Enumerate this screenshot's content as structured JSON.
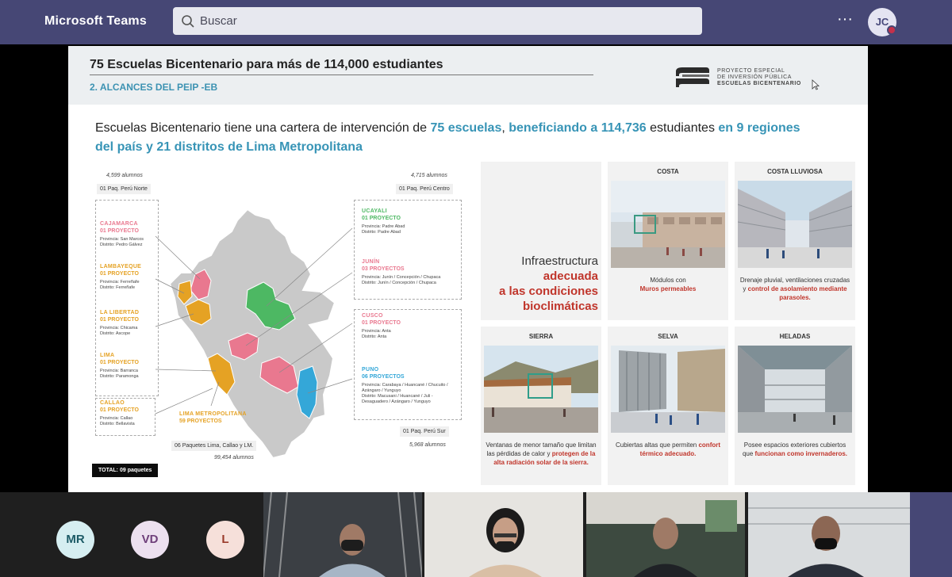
{
  "app": {
    "title": "Microsoft Teams",
    "search_placeholder": "Buscar",
    "more": "···",
    "user_initials": "JC"
  },
  "slide": {
    "title": "75 Escuelas Bicentenario para más de 114,000 estudiantes",
    "subtitle": "2. ALCANCES DEL PEIP -EB",
    "logo_lines": [
      "PROYECTO ESPECIAL",
      "DE INVERSIÓN PÚBLICA",
      "ESCUELAS BICENTENARIO"
    ],
    "lead": {
      "p1": "Escuelas Bicentenario tiene una cartera de intervención de ",
      "h1": "75 escuelas",
      "p2": ", ",
      "h2": "beneficiando a 114,736",
      "p3": " estudiantes",
      "h3": " en 9 regiones del país y 21 distritos de Lima Metropolitana"
    },
    "packages": {
      "norte": {
        "label": "01 Paq. Perú Norte",
        "alumnos": "4,599 alumnos"
      },
      "centro": {
        "label": "01 Paq. Perú Centro",
        "alumnos": "4,715 alumnos"
      },
      "lima": {
        "label": "06 Paquetes Lima, Callao y LM.",
        "alumnos": "99,454 alumnos"
      },
      "sur": {
        "label": "01 Paq. Perú Sur",
        "alumnos": "5,968 alumnos"
      },
      "total": "TOTAL: 09 paquetes"
    },
    "regions": [
      {
        "name": "CAJAMARCA",
        "proj": "01 PROYECTO",
        "prov": "Provincia: San Marcos",
        "dist": "Distrito: Pedro Gálvez",
        "color": "#e9788f"
      },
      {
        "name": "LAMBAYEQUE",
        "proj": "01 PROYECTO",
        "prov": "Provincia: Ferreñafe",
        "dist": "Distrito: Ferreñafe",
        "color": "#e5a224"
      },
      {
        "name": "LA LIBERTAD",
        "proj": "01 PROYECTO",
        "prov": "Provincia: Chicama",
        "dist": "Distrito: Ascope",
        "color": "#e5a224"
      },
      {
        "name": "LIMA",
        "proj": "01 PROYECTO",
        "prov": "Provincia: Barranca",
        "dist": "Distrito: Paramonga",
        "color": "#e5a224"
      },
      {
        "name": "CALLAO",
        "proj": "01 PROYECTO",
        "prov": "Provincia: Callao",
        "dist": "Distrito: Bellavista",
        "color": "#e5a224"
      },
      {
        "name": "LIMA METROPOLITANA",
        "proj": "59 PROYECTOS",
        "color": "#e5a224"
      },
      {
        "name": "UCAYALI",
        "proj": "01 PROYECTO",
        "prov": "Provincia: Padre Abad",
        "dist": "Distrito: Padre Abad",
        "color": "#4db863"
      },
      {
        "name": "JUNÍN",
        "proj": "03 PROYECTOS",
        "prov": "Provincia: Junín / Concepción / Chupaca",
        "dist": "Distrito: Junín / Concepción / Chupaca",
        "color": "#e9788f"
      },
      {
        "name": "CUSCO",
        "proj": "01 PROYECTO",
        "prov": "Provincia: Anta",
        "dist": "Distrito: Anta",
        "color": "#e9788f"
      },
      {
        "name": "PUNO",
        "proj": "06 PROYECTOS",
        "prov": "Provincia: Carabaya / Huancané / Chucuito / Azángaro / Yunguyo",
        "dist": "Distrito: Macusani / Huancané / Juli - Desaguadero / Azángaro / Yunguyo",
        "color": "#34a7d8"
      }
    ],
    "info": {
      "l1": "Infraestructura",
      "l2": "adecuada",
      "l3": "a las condiciones",
      "l4": "bioclimáticas"
    },
    "climates": [
      {
        "title": "COSTA",
        "c1": "Módulos con",
        "c2": "Muros permeables",
        "c3": ""
      },
      {
        "title": "COSTA LLUVIOSA",
        "c1": "Drenaje pluvial, ventilaciones cruzadas y ",
        "c2": "control de asolamiento mediante parasoles.",
        "c3": ""
      },
      {
        "title": "SIERRA",
        "c1": "Ventanas de menor tamaño que limitan las pérdidas de calor y ",
        "c2": "protegen de la alta radiación solar de  la sierra.",
        "c3": ""
      },
      {
        "title": "SELVA",
        "c1": "Cubiertas altas que permiten ",
        "c2": "confort térmico adecuado.",
        "c3": ""
      },
      {
        "title": "HELADAS",
        "c1": "Posee espacios exteriores cubiertos que ",
        "c2": "funcionan como invernaderos.",
        "c3": ""
      }
    ]
  },
  "participants": [
    {
      "initials": "MR",
      "bg": "#d6eef1",
      "fg": "#1c5a66"
    },
    {
      "initials": "VD",
      "bg": "#ece0ef",
      "fg": "#6e3f7a"
    },
    {
      "initials": "L",
      "bg": "#f6e0da",
      "fg": "#9a3b2b"
    }
  ]
}
